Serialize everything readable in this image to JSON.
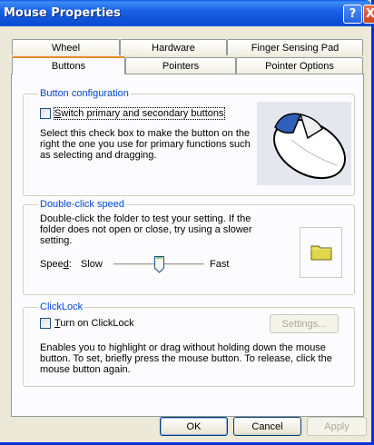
{
  "window": {
    "title": "Mouse Properties",
    "help_glyph": "?",
    "close_glyph": "X"
  },
  "tabs": {
    "row_back": [
      {
        "label": "Wheel"
      },
      {
        "label": "Hardware"
      },
      {
        "label": "Finger Sensing Pad"
      }
    ],
    "row_front": [
      {
        "label": "Buttons",
        "active": true
      },
      {
        "label": "Pointers"
      },
      {
        "label": "Pointer Options"
      }
    ]
  },
  "button_config": {
    "title": "Button configuration",
    "checkbox_label_first": "S",
    "checkbox_label_rest": "witch primary and secondary buttons",
    "checked": false,
    "description_lines": [
      "Select this check box to make the button on the",
      "right the one you use for primary functions such",
      "as selecting and dragging."
    ]
  },
  "double_click": {
    "title": "Double-click speed",
    "description_lines": [
      "Double-click the folder to test your setting. If the",
      "folder does not open or close, try using a slower",
      "setting."
    ],
    "speed_label_first": "Spee",
    "speed_label_ul": "d",
    "speed_label_colon": ":",
    "slow_label": "Slow",
    "fast_label": "Fast",
    "speed_value": 0.5
  },
  "clicklock": {
    "title": "ClickLock",
    "checkbox_label_first": "T",
    "checkbox_label_rest": "urn on ClickLock",
    "checked": false,
    "settings_button": "Settings...",
    "description_lines": [
      "Enables you to highlight or drag without holding down the mouse",
      "button. To set, briefly press the mouse button. To release, click the",
      "mouse button again."
    ]
  },
  "footer": {
    "ok_label": "OK",
    "cancel_label": "Cancel",
    "apply_label": "Apply"
  }
}
